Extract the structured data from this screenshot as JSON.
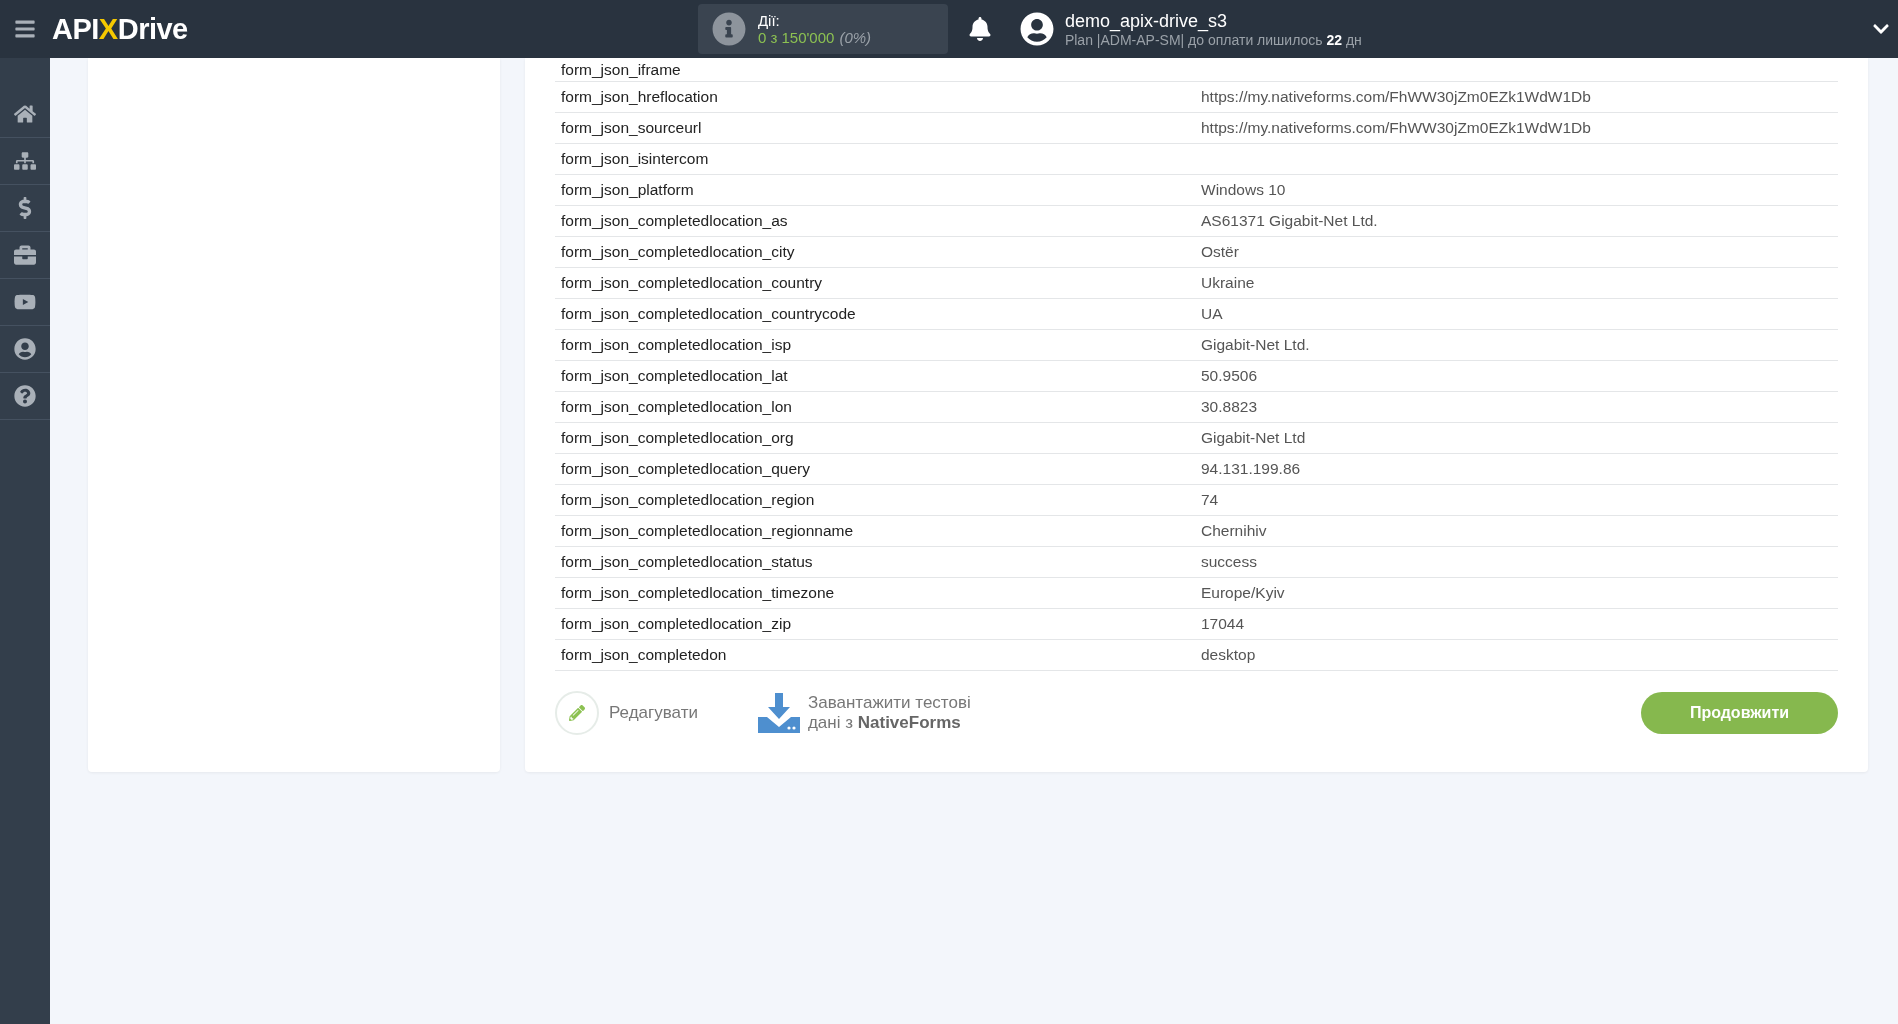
{
  "header": {
    "logo": {
      "prefix": "API",
      "mark": "X",
      "suffix": "Drive"
    },
    "actions": {
      "label": "Дії:",
      "count": "0 з 150'000",
      "percent": "(0%)"
    },
    "user": {
      "name": "demo_apix-drive_s3",
      "plan": "Plan |ADM-AP-SM| до оплати лишилось **22** дн"
    }
  },
  "table": {
    "rows": [
      {
        "field": "form_json_iframe",
        "value": ""
      },
      {
        "field": "form_json_hreflocation",
        "value": "https://my.nativeforms.com/FhWW30jZm0EZk1WdW1Db"
      },
      {
        "field": "form_json_sourceurl",
        "value": "https://my.nativeforms.com/FhWW30jZm0EZk1WdW1Db"
      },
      {
        "field": "form_json_isintercom",
        "value": ""
      },
      {
        "field": "form_json_platform",
        "value": "Windows 10"
      },
      {
        "field": "form_json_completedlocation_as",
        "value": "AS61371 Gigabit-Net Ltd."
      },
      {
        "field": "form_json_completedlocation_city",
        "value": "Ostër"
      },
      {
        "field": "form_json_completedlocation_country",
        "value": "Ukraine"
      },
      {
        "field": "form_json_completedlocation_countrycode",
        "value": "UA"
      },
      {
        "field": "form_json_completedlocation_isp",
        "value": "Gigabit-Net Ltd."
      },
      {
        "field": "form_json_completedlocation_lat",
        "value": "50.9506"
      },
      {
        "field": "form_json_completedlocation_lon",
        "value": "30.8823"
      },
      {
        "field": "form_json_completedlocation_org",
        "value": "Gigabit-Net Ltd"
      },
      {
        "field": "form_json_completedlocation_query",
        "value": "94.131.199.86"
      },
      {
        "field": "form_json_completedlocation_region",
        "value": "74"
      },
      {
        "field": "form_json_completedlocation_regionname",
        "value": "Chernihiv"
      },
      {
        "field": "form_json_completedlocation_status",
        "value": "success"
      },
      {
        "field": "form_json_completedlocation_timezone",
        "value": "Europe/Kyiv"
      },
      {
        "field": "form_json_completedlocation_zip",
        "value": "17044"
      },
      {
        "field": "form_json_completedon",
        "value": "desktop"
      }
    ]
  },
  "actions": {
    "edit": "Редагувати",
    "download": "Завантажити тестові дані з **NativeForms**",
    "continue": "Продовжити"
  }
}
